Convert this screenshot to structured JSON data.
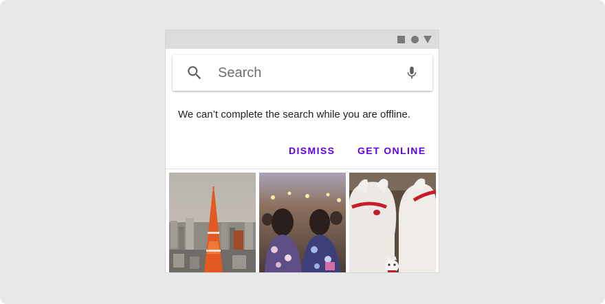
{
  "search": {
    "placeholder": "Search",
    "search_icon": "search-icon",
    "mic_icon": "mic-icon"
  },
  "status_bar": {
    "icons": [
      "square-icon",
      "circle-icon",
      "triangle-icon"
    ]
  },
  "message": {
    "text": "We can’t complete the search while you are offline."
  },
  "actions": {
    "dismiss_label": "DISMISS",
    "get_online_label": "GET ONLINE"
  },
  "colors": {
    "accent": "#6200EE",
    "background": "#E8E8E8",
    "status_bar": "#DCDCDC"
  },
  "gallery": {
    "images": [
      {
        "subject": "tokyo-tower-city-photo"
      },
      {
        "subject": "festival-crowd-photo"
      },
      {
        "subject": "lucky-cat-figurines-photo"
      }
    ]
  }
}
